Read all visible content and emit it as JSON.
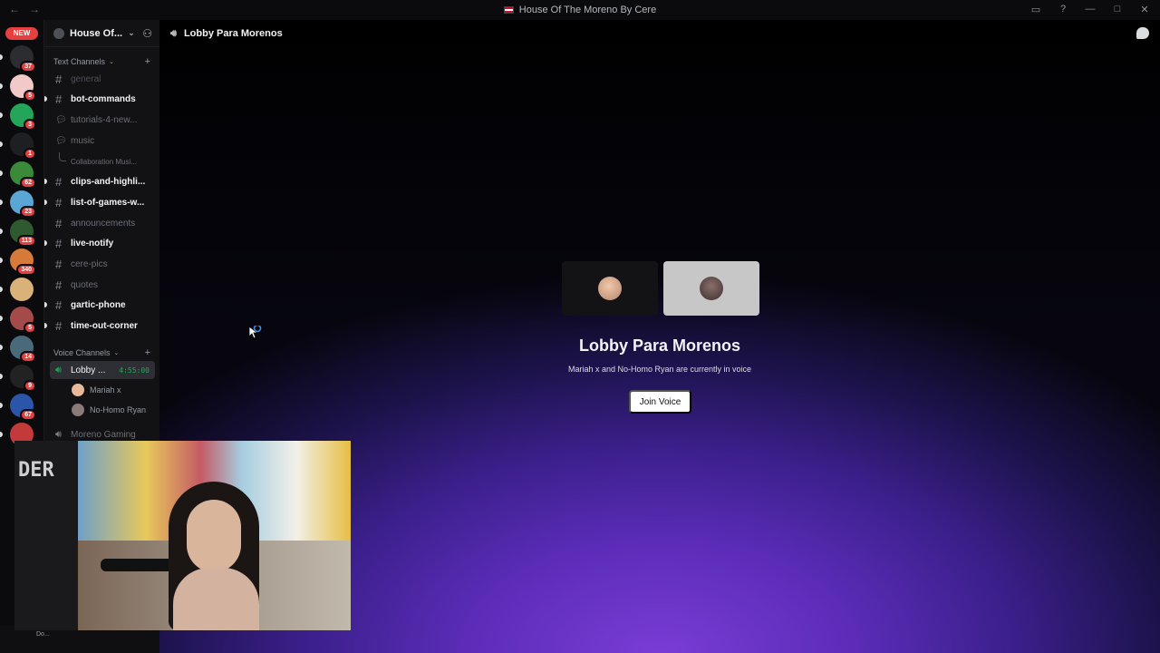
{
  "window": {
    "title": "House Of The Moreno By Cere"
  },
  "rail": {
    "new_label": "NEW",
    "servers": [
      {
        "badge": "37",
        "color": "#2b2d31"
      },
      {
        "badge": "5",
        "color": "#f2c9c9"
      },
      {
        "badge": "3",
        "color": "#23a55a"
      },
      {
        "badge": "1",
        "color": "#1e1f22"
      },
      {
        "badge": "62",
        "color": "#3a8a3a"
      },
      {
        "badge": "23",
        "color": "#5aa7d6"
      },
      {
        "badge": "113",
        "color": "#2f5a2f"
      },
      {
        "badge": "340",
        "color": "#d67a3a"
      },
      {
        "badge": "",
        "color": "#d9b27a"
      },
      {
        "badge": "5",
        "color": "#a44a4a"
      },
      {
        "badge": "14",
        "color": "#4a6a7a"
      },
      {
        "badge": "9",
        "color": "#222222"
      },
      {
        "badge": "67",
        "color": "#2a55a8"
      },
      {
        "badge": "",
        "color": "#c43a3a"
      }
    ]
  },
  "server": {
    "name": "House Of..."
  },
  "sidebar": {
    "text_category": "Text Channels",
    "text_channels": [
      {
        "name": "general",
        "state": "dim",
        "icon": "hash-icon",
        "pip": false
      },
      {
        "name": "bot-commands",
        "state": "unread",
        "icon": "hash-icon",
        "pip": true
      },
      {
        "name": "tutorials-4-new...",
        "state": "muted",
        "icon": "forum-icon",
        "pip": false
      },
      {
        "name": "music",
        "state": "muted",
        "icon": "forum-icon",
        "pip": false
      },
      {
        "name": "Collaboration Musi...",
        "state": "thread",
        "icon": "",
        "pip": false
      },
      {
        "name": "clips-and-highli...",
        "state": "unread",
        "icon": "hash-icon",
        "pip": true
      },
      {
        "name": "list-of-games-w...",
        "state": "unread",
        "icon": "hash-icon",
        "pip": true
      },
      {
        "name": "announcements",
        "state": "muted",
        "icon": "hash-icon",
        "pip": false
      },
      {
        "name": "live-notify",
        "state": "unread",
        "icon": "hash-icon",
        "pip": true
      },
      {
        "name": "cere-pics",
        "state": "muted",
        "icon": "hash-icon",
        "pip": false
      },
      {
        "name": "quotes",
        "state": "muted",
        "icon": "hash-icon",
        "pip": false
      },
      {
        "name": "gartic-phone",
        "state": "unread",
        "icon": "hash-icon",
        "pip": true
      },
      {
        "name": "time-out-corner",
        "state": "unread",
        "icon": "hash-icon",
        "pip": true
      }
    ],
    "voice_category": "Voice Channels",
    "voice_active": {
      "name": "Lobby ...",
      "timer": "4:55:00"
    },
    "voice_users": [
      {
        "name": "Mariah x",
        "avatar_color": "#e8b89a"
      },
      {
        "name": "No-Homo Ryan",
        "avatar_color": "#8a7a7a"
      }
    ],
    "voice_other": "Moreno Gaming"
  },
  "main": {
    "channel_title": "Lobby Para Morenos",
    "vc_title": "Lobby Para Morenos",
    "vc_subtitle": "Mariah x and No-Homo Ryan are currently in voice",
    "join_label": "Join Voice"
  },
  "userbar": {
    "name": "Do..."
  },
  "webcam": {
    "sign_text": "DER"
  },
  "colors": {
    "accent_green": "#23a55a",
    "badge_red": "#e53f3f",
    "gradient_purple": "#7a3dd6"
  }
}
